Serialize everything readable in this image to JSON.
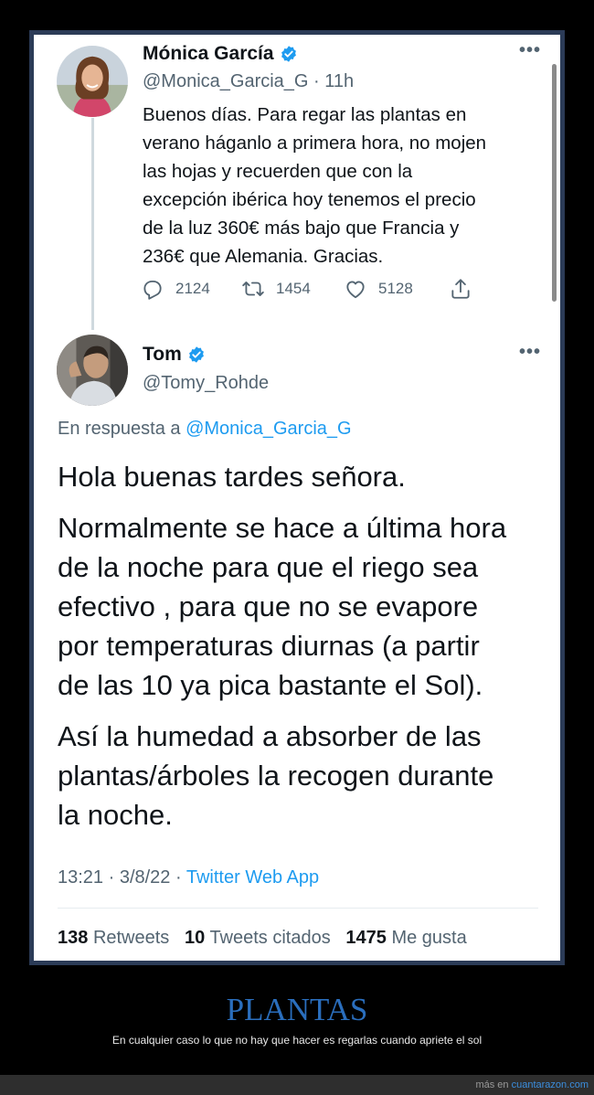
{
  "tweet1": {
    "author_name": "Mónica García",
    "handle": "@Monica_Garcia_G",
    "time": "11h",
    "text_lines": [
      "Buenos días. Para regar las plantas en",
      "verano háganlo a primera hora, no mojen",
      "las hojas y recuerden que con la",
      "excepción ibérica hoy tenemos el precio",
      "de la luz 360€ más bajo que Francia y",
      "236€ que Alemania. Gracias."
    ],
    "replies": "2124",
    "retweets": "1454",
    "likes": "5128",
    "icons": [
      "reply-icon",
      "retweet-icon",
      "like-icon",
      "share-icon",
      "verified-badge-icon",
      "more-icon"
    ]
  },
  "tweet2": {
    "author_name": "Tom",
    "handle": "@Tomy_Rohde",
    "reply_prefix": "En respuesta a",
    "reply_handle": "@Monica_Garcia_G",
    "paragraphs": [
      [
        "Hola buenas tardes señora."
      ],
      [
        "Normalmente se hace a última hora",
        "de la noche para que el riego sea",
        "efectivo , para que no se evapore",
        "por temperaturas diurnas (a partir",
        "de las 10  ya pica bastante el Sol)."
      ],
      [
        "Así la humedad a absorber de las",
        "plantas/árboles la recogen durante",
        "la noche."
      ]
    ],
    "timestamp": "13:21 · 3/8/22 ·",
    "app": "Twitter Web App",
    "stats": {
      "retweets_count": "138",
      "retweets_label": "Retweets",
      "quotes_count": "10",
      "quotes_label": "Tweets citados",
      "likes_count": "1475",
      "likes_label": "Me gusta"
    }
  },
  "post": {
    "title": "PLANTAS",
    "subtitle": "En cualquier caso lo que no hay que hacer es regarlas cuando apriete el sol"
  },
  "footer": {
    "prefix": "más en",
    "site": "cuantarazon.com"
  },
  "colors": {
    "link": "#1d9bf0",
    "verified": "#1d9bf0",
    "title": "#2a6ebd",
    "frame_border": "#2b3b57"
  }
}
